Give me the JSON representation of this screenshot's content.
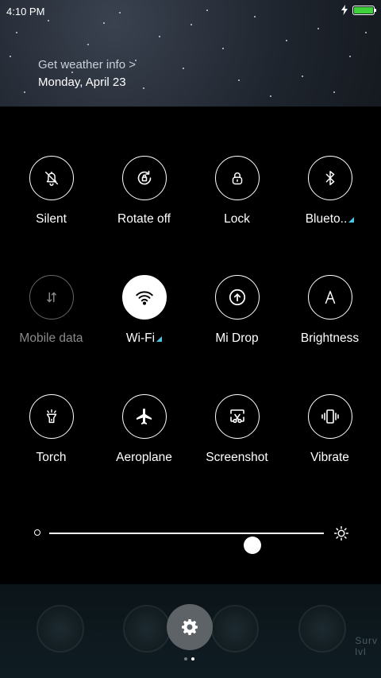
{
  "status_bar": {
    "time": "4:10 PM",
    "battery_level": 1.0,
    "battery_color": "#3ed13a",
    "charging_icon": "bolt-icon"
  },
  "header": {
    "weather_link": "Get weather info >",
    "date": "Monday, April 23"
  },
  "tiles": [
    {
      "label": "Silent",
      "icon": "bell-off-icon",
      "state": "off"
    },
    {
      "label": "Rotate off",
      "icon": "rotate-lock-icon",
      "state": "off"
    },
    {
      "label": "Lock",
      "icon": "lock-icon",
      "state": "off"
    },
    {
      "label": "Blueto..",
      "icon": "bluetooth-icon",
      "state": "off",
      "has_more": true
    },
    {
      "label": "Mobile data",
      "icon": "mobile-data-icon",
      "state": "disabled"
    },
    {
      "label": "Wi-Fi",
      "icon": "wifi-icon",
      "state": "on",
      "has_more": true
    },
    {
      "label": "Mi Drop",
      "icon": "mi-drop-icon",
      "state": "off"
    },
    {
      "label": "Brightness",
      "icon": "brightness-auto-icon",
      "state": "off"
    },
    {
      "label": "Torch",
      "icon": "torch-icon",
      "state": "off"
    },
    {
      "label": "Aeroplane",
      "icon": "airplane-icon",
      "state": "off"
    },
    {
      "label": "Screenshot",
      "icon": "screenshot-icon",
      "state": "off"
    },
    {
      "label": "Vibrate",
      "icon": "vibrate-icon",
      "state": "off"
    }
  ],
  "brightness": {
    "level": 0.74
  },
  "dock": {
    "partial_label_top": "Surv",
    "partial_label_bottom": "lvl",
    "active_page": 2,
    "page_count": 2
  },
  "colors": {
    "accent": "#4ec5e0",
    "gear_button": "#5e6368"
  }
}
